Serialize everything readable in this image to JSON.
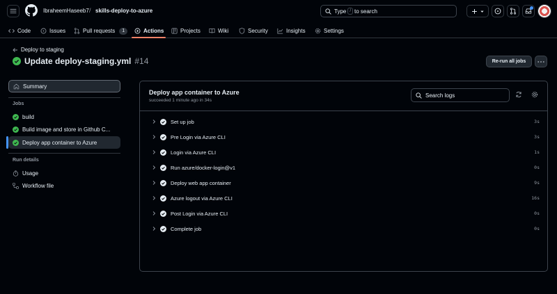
{
  "header": {
    "owner": "IbraheemHaseeb7",
    "separator": "/",
    "repo": "skills-deploy-to-azure",
    "search": {
      "prefix": "Type",
      "key": "/",
      "suffix": "to search"
    },
    "plus_label": "+",
    "icons": [
      "menu-icon",
      "github-logo-icon",
      "plus-icon",
      "chevron-down-icon",
      "issues-icon",
      "pull-request-icon",
      "inbox-icon"
    ]
  },
  "tabs": [
    {
      "label": "Code"
    },
    {
      "label": "Issues"
    },
    {
      "label": "Pull requests",
      "count": "1"
    },
    {
      "label": "Actions"
    },
    {
      "label": "Projects"
    },
    {
      "label": "Wiki"
    },
    {
      "label": "Security"
    },
    {
      "label": "Insights"
    },
    {
      "label": "Settings"
    }
  ],
  "run": {
    "back_label": "Deploy to staging",
    "title": "Update deploy-staging.yml",
    "number": "#14",
    "rerun_label": "Re-run all jobs"
  },
  "sidebar": {
    "summary_label": "Summary",
    "jobs_heading": "Jobs",
    "jobs": [
      {
        "label": "build"
      },
      {
        "label": "Build image and store in Github C..."
      },
      {
        "label": "Deploy app container to Azure"
      }
    ],
    "run_details_heading": "Run details",
    "run_details": [
      {
        "label": "Usage"
      },
      {
        "label": "Workflow file"
      }
    ]
  },
  "job": {
    "title": "Deploy app container to Azure",
    "subtitle": "succeeded 1 minute ago in 34s",
    "search_placeholder": "Search logs",
    "steps": [
      {
        "name": "Set up job",
        "duration": "3s"
      },
      {
        "name": "Pre Login via Azure CLI",
        "duration": "3s"
      },
      {
        "name": "Login via Azure CLI",
        "duration": "1s"
      },
      {
        "name": "Run azure/docker-login@v1",
        "duration": "0s"
      },
      {
        "name": "Deploy web app container",
        "duration": "9s"
      },
      {
        "name": "Azure logout via Azure CLI",
        "duration": "16s"
      },
      {
        "name": "Post Login via Azure CLI",
        "duration": "0s"
      },
      {
        "name": "Complete job",
        "duration": "0s"
      }
    ]
  },
  "colors": {
    "background": "#010409",
    "border": "#30363d",
    "success": "#3fb950",
    "accent_tab": "#f78166",
    "selected_bar": "#4493f8"
  }
}
